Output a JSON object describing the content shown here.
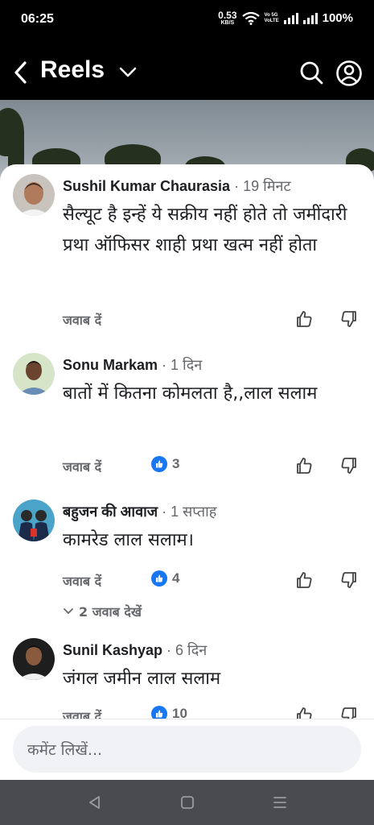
{
  "status_bar": {
    "time": "06:25",
    "net_speed_value": "0.53",
    "net_speed_unit": "KB/S",
    "volte_line1": "Vo 5G",
    "volte_line2": "VoLTE",
    "battery": "100%"
  },
  "header": {
    "title": "Reels"
  },
  "comments": [
    {
      "name": "Sushil Kumar Chaurasia",
      "separator": " · ",
      "time": "19 मिनट",
      "text": "सैल्यूट है इन्हें ये सक्रीय नहीं होते तो जमींदारी प्रथा ऑफिसर शाही प्रथा खत्म नहीं होता",
      "reply_label": "जवाब दें"
    },
    {
      "name": "Sonu Markam",
      "separator": " · ",
      "time": "1 दिन",
      "text": "बातों में कितना कोमलता है,,लाल सलाम",
      "reply_label": "जवाब दें",
      "reaction_count": "3"
    },
    {
      "name": "बहुजन की आवाज",
      "separator": " · ",
      "time": "1 सप्ताह",
      "text": "कामरेड लाल सलाम।",
      "reply_label": "जवाब दें",
      "reaction_count": "4"
    },
    {
      "name": "Sunil Kashyap",
      "separator": " · ",
      "time": "6 दिन",
      "text": "जंगल जमीन लाल सलाम",
      "reply_label": "जवाब दें",
      "reaction_count": "10"
    }
  ],
  "view_replies_label": "2 जवाब देखें",
  "composer": {
    "placeholder": "कमेंट लिखें..."
  },
  "colors": {
    "like_blue": "#1877f2",
    "secondary_text": "#65676b",
    "nav_bar": "#4a4b50"
  },
  "icons": [
    "back-arrow-icon",
    "chevron-down-icon",
    "search-icon",
    "profile-icon",
    "thumbs-up-icon",
    "thumbs-down-icon",
    "like-reaction-icon",
    "back-nav-icon",
    "home-nav-icon",
    "menu-nav-icon"
  ]
}
